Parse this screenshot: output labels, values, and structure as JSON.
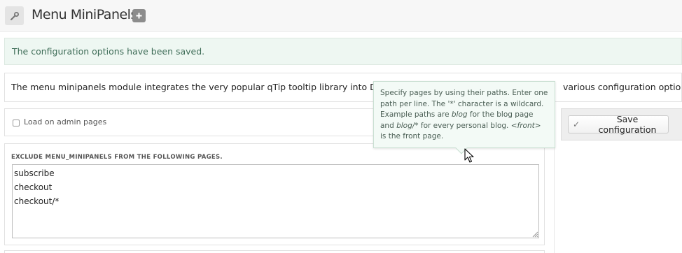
{
  "header": {
    "title": "Menu MiniPanels",
    "wrench_icon": "wrench-icon",
    "add_icon": "plus-icon"
  },
  "status": {
    "message": "The configuration options have been saved."
  },
  "description": {
    "text_left": "The menu minipanels module integrates the very popular qTip tooltip library into Drupal",
    "text_right": "various configuration options."
  },
  "settings": {
    "load_admin_label": "Load on admin pages",
    "load_admin_checked": false,
    "exclude_label": "EXCLUDE MENU_MINIPANELS FROM THE FOLLOWING PAGES.",
    "exclude_pages": "subscribe\ncheckout\ncheckout/*"
  },
  "actions": {
    "save_label": "Save configuration",
    "save_icon": "check-icon"
  },
  "tooltip": {
    "part1": "Specify pages by using their paths. Enter one path per line. The '*' character is a wildcard. Example paths are ",
    "example1": "blog",
    "part2": " for the blog page and ",
    "example2": "blog/*",
    "part3": " for every personal blog. ",
    "example3": "<front>",
    "part4": " is the front page."
  },
  "colors": {
    "status_bg": "#eef7f2",
    "status_text": "#3f6d58",
    "tooltip_bg": "#f3faf6",
    "header_bg": "#f7f7f7"
  }
}
